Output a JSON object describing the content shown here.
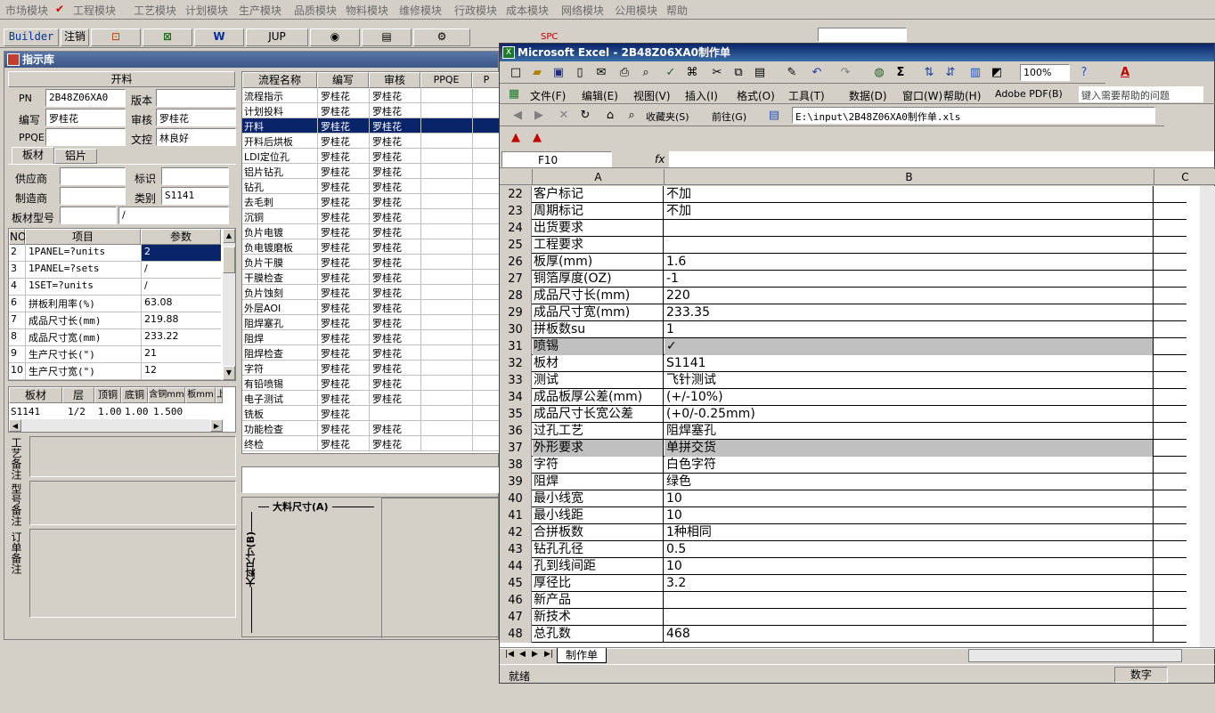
{
  "top_menu": [
    "市场模块",
    "工程模块",
    "工艺模块",
    "计划模块",
    "生产模块",
    "品质模块",
    "物料模块",
    "维修模块",
    "行政模块",
    "成本模块",
    "网络模块",
    "公用模块",
    "帮助"
  ],
  "app_toolbar": {
    "builder": "Builder",
    "logout": "注销",
    "jup": "JUP",
    "spc": "SPC"
  },
  "zsk": {
    "title": "指示库",
    "section_title": "开料",
    "pn_label": "PN",
    "pn_value": "2B48Z06XA0",
    "version_label": "版本",
    "version_value": "",
    "author_label": "编写",
    "author_value": "罗桂花",
    "reviewer_label": "审核",
    "reviewer_value": "罗桂花",
    "ppqe_label": "PPQE",
    "ppqe_value": "",
    "doc_label": "文控",
    "doc_value": "林良好",
    "tabs": [
      "板材",
      "铝片"
    ],
    "supplier_label": "供应商",
    "supplier_value": "",
    "mark_label": "标识",
    "mark_value": "",
    "maker_label": "制造商",
    "maker_value": "",
    "type_label": "类别",
    "type_value": "S1141",
    "model_label": "板材型号",
    "model_value": "",
    "model_value2": "/",
    "param_headers": [
      "NO",
      "项目",
      "参数"
    ],
    "params": [
      {
        "no": "2",
        "item": "1PANEL=?units",
        "val": "2"
      },
      {
        "no": "3",
        "item": "1PANEL=?sets",
        "val": "/"
      },
      {
        "no": "4",
        "item": "1SET=?units",
        "val": "/"
      },
      {
        "no": "6",
        "item": "拼板利用率(%)",
        "val": "63.08"
      },
      {
        "no": "7",
        "item": "成品尺寸长(mm)",
        "val": "219.88"
      },
      {
        "no": "8",
        "item": "成品尺寸宽(mm)",
        "val": "233.22"
      },
      {
        "no": "9",
        "item": "生产尺寸长(\")",
        "val": "21"
      },
      {
        "no": "10",
        "item": "生产尺寸宽(\")",
        "val": "12"
      }
    ],
    "mat_headers": [
      "板材",
      "层",
      "顶铜",
      "底铜",
      "含铜mm",
      "板mm",
      "上"
    ],
    "mat_row": [
      "S1141",
      "1/2",
      "1.00",
      "1.00",
      "1.500"
    ],
    "notes": [
      "工艺备注",
      "型号备注",
      "订单备注"
    ],
    "flow_headers": [
      "流程名称",
      "编写",
      "审核",
      "PPQE",
      "P"
    ],
    "flows": [
      {
        "name": "流程指示",
        "a": "罗桂花",
        "b": "罗桂花"
      },
      {
        "name": "计划投料",
        "a": "罗桂花",
        "b": "罗桂花"
      },
      {
        "name": "开料",
        "a": "罗桂花",
        "b": "罗桂花"
      },
      {
        "name": "开料后烘板",
        "a": "罗桂花",
        "b": "罗桂花"
      },
      {
        "name": "LDI定位孔",
        "a": "罗桂花",
        "b": "罗桂花"
      },
      {
        "name": "铝片钻孔",
        "a": "罗桂花",
        "b": "罗桂花"
      },
      {
        "name": "钻孔",
        "a": "罗桂花",
        "b": "罗桂花"
      },
      {
        "name": "去毛刺",
        "a": "罗桂花",
        "b": "罗桂花"
      },
      {
        "name": "沉铜",
        "a": "罗桂花",
        "b": "罗桂花"
      },
      {
        "name": "负片电镀",
        "a": "罗桂花",
        "b": "罗桂花"
      },
      {
        "name": "负电镀磨板",
        "a": "罗桂花",
        "b": "罗桂花"
      },
      {
        "name": "负片干膜",
        "a": "罗桂花",
        "b": "罗桂花"
      },
      {
        "name": "干膜检查",
        "a": "罗桂花",
        "b": "罗桂花"
      },
      {
        "name": "负片蚀刻",
        "a": "罗桂花",
        "b": "罗桂花"
      },
      {
        "name": "外层AOI",
        "a": "罗桂花",
        "b": "罗桂花"
      },
      {
        "name": "阻焊塞孔",
        "a": "罗桂花",
        "b": "罗桂花"
      },
      {
        "name": "阻焊",
        "a": "罗桂花",
        "b": "罗桂花"
      },
      {
        "name": "阻焊检查",
        "a": "罗桂花",
        "b": "罗桂花"
      },
      {
        "name": "字符",
        "a": "罗桂花",
        "b": "罗桂花"
      },
      {
        "name": "有铅喷锡",
        "a": "罗桂花",
        "b": "罗桂花"
      },
      {
        "name": "电子测试",
        "a": "罗桂花",
        "b": "罗桂花"
      },
      {
        "name": "铣板",
        "a": "罗桂花",
        "b": ""
      },
      {
        "name": "功能检查",
        "a": "罗桂花",
        "b": "罗桂花"
      },
      {
        "name": "终检",
        "a": "罗桂花",
        "b": "罗桂花"
      }
    ],
    "dim_a": "大料尺寸(A)",
    "dim_b": "大料尺寸(B)"
  },
  "excel": {
    "title": "Microsoft Excel - 2B48Z06XA0制作单",
    "menus": [
      "文件(F)",
      "编辑(E)",
      "视图(V)",
      "插入(I)",
      "格式(O)",
      "工具(T)",
      "数据(D)",
      "窗口(W)",
      "帮助(H)",
      "Adobe PDF(B)"
    ],
    "help_placeholder": "键入需要帮助的问题",
    "zoom": "100%",
    "favorites": "收藏夹(S)",
    "goto": "前往(G)",
    "path": "E:\\input\\2B48Z06XA0制作单.xls",
    "name_box": "F10",
    "fx": "fx",
    "col_headers": [
      "A",
      "B",
      "C"
    ],
    "rows": [
      {
        "n": "22",
        "a": "客户标记",
        "b": "不加"
      },
      {
        "n": "23",
        "a": "周期标记",
        "b": "不加"
      },
      {
        "n": "24",
        "a": "出货要求",
        "b": ""
      },
      {
        "n": "25",
        "a": "工程要求",
        "b": ""
      },
      {
        "n": "26",
        "a": "板厚(mm)",
        "b": "1.6"
      },
      {
        "n": "27",
        "a": "铜箔厚度(OZ)",
        "b": "-1"
      },
      {
        "n": "28",
        "a": "成品尺寸长(mm)",
        "b": "220"
      },
      {
        "n": "29",
        "a": "成品尺寸宽(mm)",
        "b": "233.35"
      },
      {
        "n": "30",
        "a": "拼板数su",
        "b": "1"
      },
      {
        "n": "31",
        "a": "喷锡",
        "b": "✓"
      },
      {
        "n": "32",
        "a": "板材",
        "b": "S1141"
      },
      {
        "n": "33",
        "a": "测试",
        "b": "飞针测试"
      },
      {
        "n": "34",
        "a": "成品板厚公差(mm)",
        "b": "(+/-10%)"
      },
      {
        "n": "35",
        "a": "成品尺寸长宽公差",
        "b": "(+0/-0.25mm)"
      },
      {
        "n": "36",
        "a": "过孔工艺",
        "b": "阻焊塞孔"
      },
      {
        "n": "37",
        "a": "外形要求",
        "b": "单拼交货"
      },
      {
        "n": "38",
        "a": "字符",
        "b": "白色字符"
      },
      {
        "n": "39",
        "a": "阻焊",
        "b": "绿色"
      },
      {
        "n": "40",
        "a": "最小线宽",
        "b": "10"
      },
      {
        "n": "41",
        "a": "最小线距",
        "b": "10"
      },
      {
        "n": "42",
        "a": "合拼板数",
        "b": "1种相同"
      },
      {
        "n": "43",
        "a": "钻孔孔径",
        "b": "0.5"
      },
      {
        "n": "44",
        "a": "孔到线间距",
        "b": "10"
      },
      {
        "n": "45",
        "a": "厚径比",
        "b": "3.2"
      },
      {
        "n": "46",
        "a": "新产品",
        "b": ""
      },
      {
        "n": "47",
        "a": "新技术",
        "b": ""
      },
      {
        "n": "48",
        "a": "总孔数",
        "b": "468"
      }
    ],
    "sheet_tab": "制作单",
    "status_left": "就绪",
    "status_right": "数字"
  },
  "colors": {
    "excel_title": "#0a246a",
    "selection": "#0a246a",
    "gray_row": "#c0c0c0"
  }
}
